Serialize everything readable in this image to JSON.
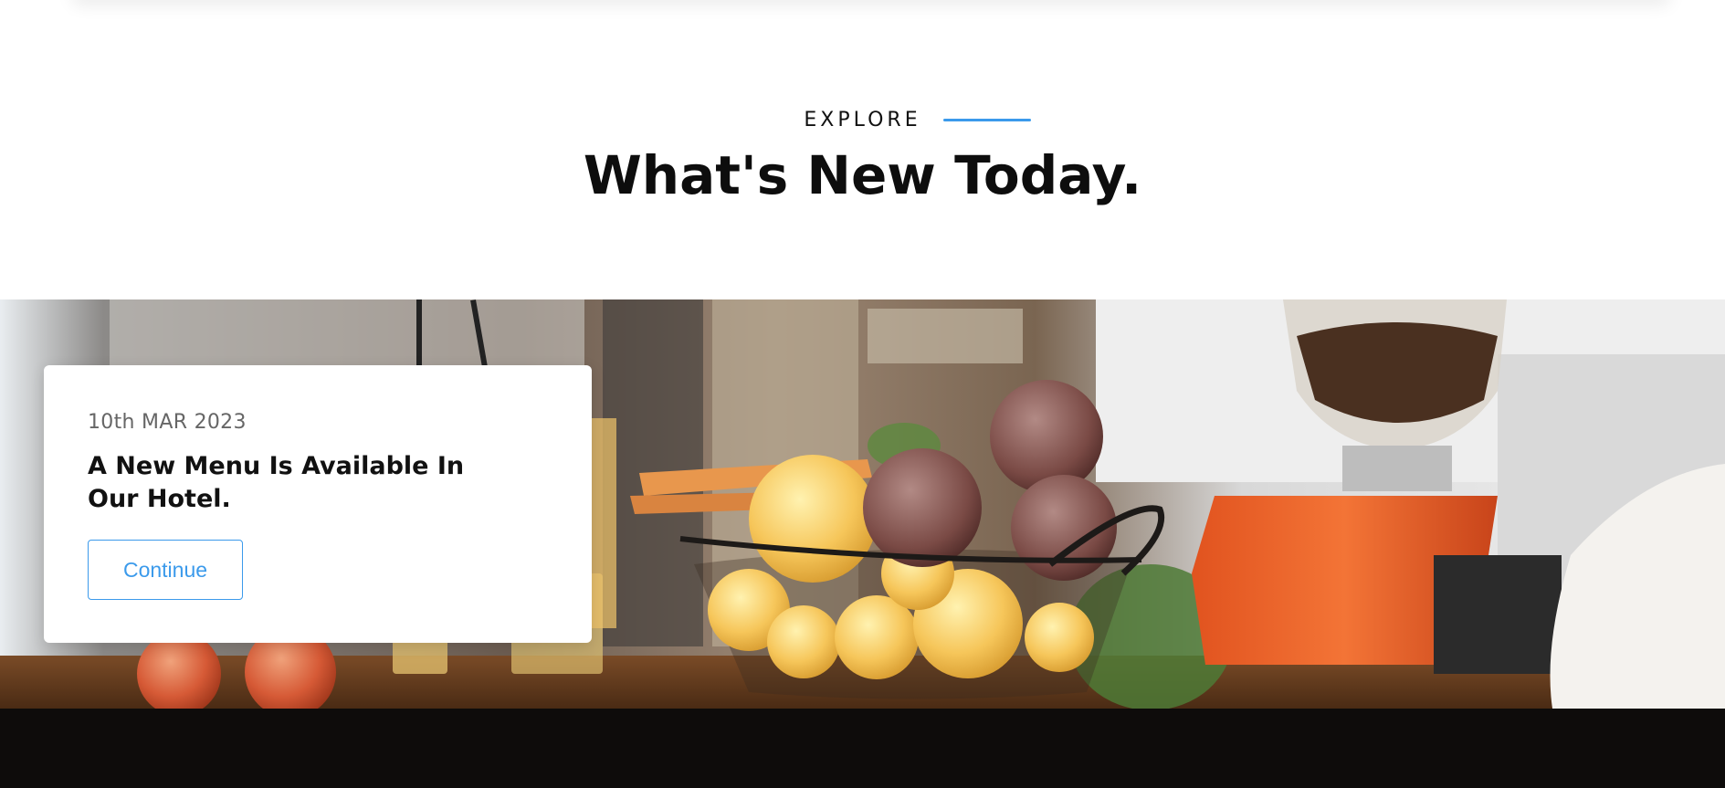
{
  "section": {
    "eyebrow": "EXPLORE",
    "title": "What's New Today."
  },
  "news": {
    "date": "10th MAR 2023",
    "title": "A New Menu Is Available In Our Hotel.",
    "button_label": "Continue"
  },
  "colors": {
    "accent": "#3b9aeb",
    "footer": "#0e0c0b"
  }
}
